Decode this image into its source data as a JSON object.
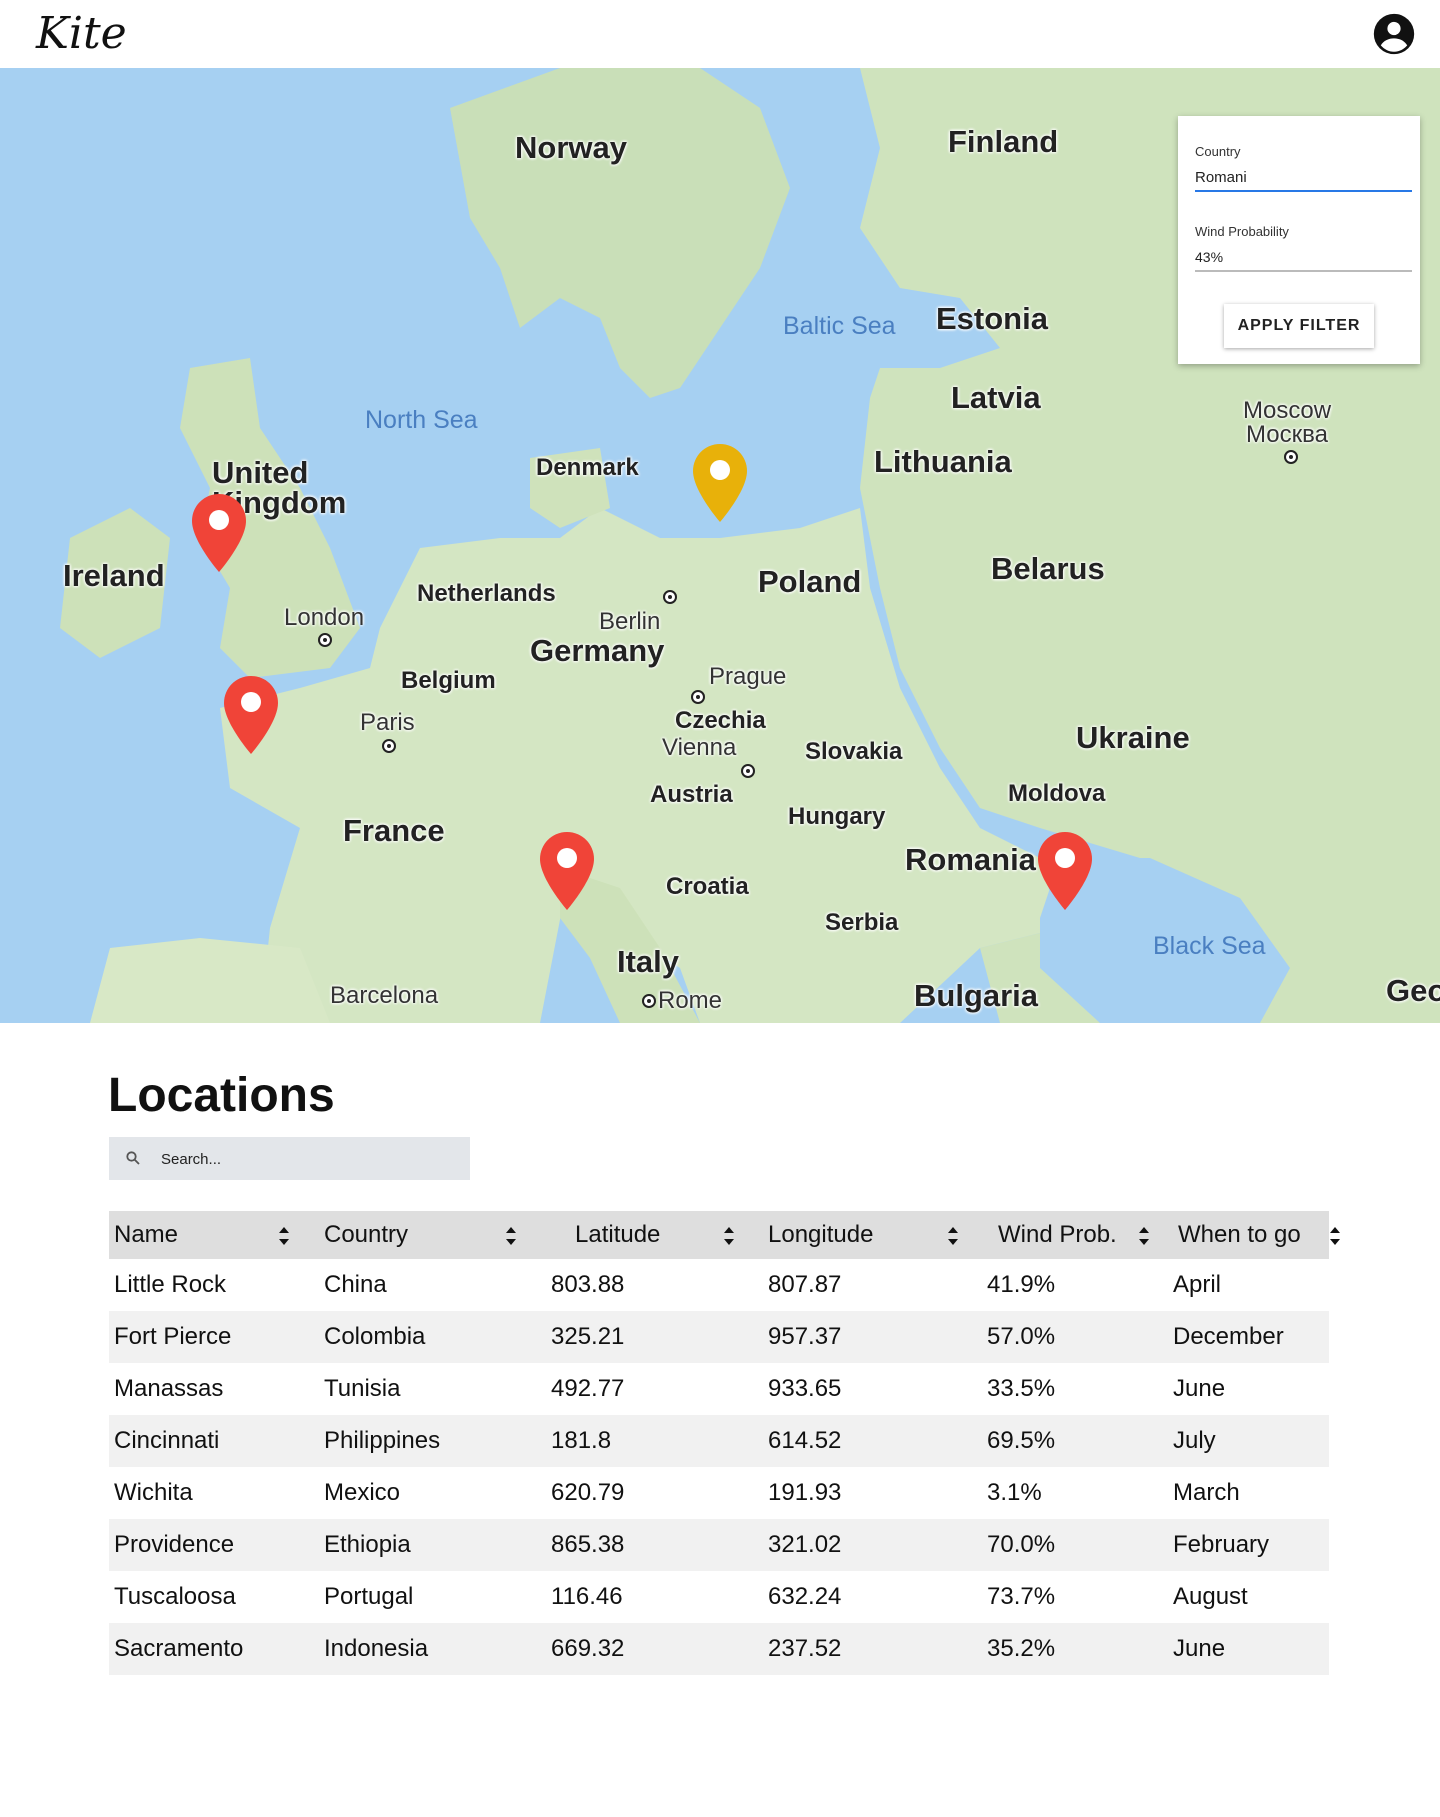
{
  "app": {
    "logo": "Kite",
    "account_icon": "account-circle-icon"
  },
  "map": {
    "countries": [
      "Norway",
      "Finland",
      "Estonia",
      "Latvia",
      "Lithuania",
      "United Kingdom",
      "Ireland",
      "Denmark",
      "Netherlands",
      "Germany",
      "Belgium",
      "Poland",
      "Belarus",
      "Czechia",
      "Slovakia",
      "Austria",
      "Hungary",
      "Ukraine",
      "Moldova",
      "Romania",
      "France",
      "Croatia",
      "Serbia",
      "Italy",
      "Bulgaria",
      "Geo"
    ],
    "cities": [
      "London",
      "Paris",
      "Berlin",
      "Prague",
      "Vienna",
      "Barcelona",
      "Rome",
      "Moscow",
      "Москва"
    ],
    "seas": [
      "North Sea",
      "Baltic Sea",
      "Black Sea"
    ],
    "pins": [
      {
        "color": "#f04438"
      },
      {
        "color": "#f04438"
      },
      {
        "color": "#f04438"
      },
      {
        "color": "#f04438"
      },
      {
        "color": "#e8b10a"
      }
    ]
  },
  "filter": {
    "country_label": "Country",
    "country_value": "Romani",
    "wind_label": "Wind Probability",
    "wind_value": "43%",
    "apply_label": "APPLY FILTER"
  },
  "locations": {
    "title": "Locations",
    "search_placeholder": "Search...",
    "columns": [
      "Name",
      "Country",
      "Latitude",
      "Longitude",
      "Wind Prob.",
      "When to go"
    ],
    "rows": [
      [
        "Little Rock",
        "China",
        "803.88",
        "807.87",
        "41.9%",
        "April"
      ],
      [
        "Fort Pierce",
        "Colombia",
        "325.21",
        "957.37",
        "57.0%",
        "December"
      ],
      [
        "Manassas",
        "Tunisia",
        "492.77",
        "933.65",
        "33.5%",
        "June"
      ],
      [
        "Cincinnati",
        "Philippines",
        "181.8",
        "614.52",
        "69.5%",
        "July"
      ],
      [
        "Wichita",
        "Mexico",
        "620.79",
        "191.93",
        "3.1%",
        "March"
      ],
      [
        "Providence",
        "Ethiopia",
        "865.38",
        "321.02",
        "70.0%",
        "February"
      ],
      [
        "Tuscaloosa",
        "Portugal",
        "116.46",
        "632.24",
        "73.7%",
        "August"
      ],
      [
        "Sacramento",
        "Indonesia",
        "669.32",
        "237.52",
        "35.2%",
        "June"
      ]
    ]
  }
}
